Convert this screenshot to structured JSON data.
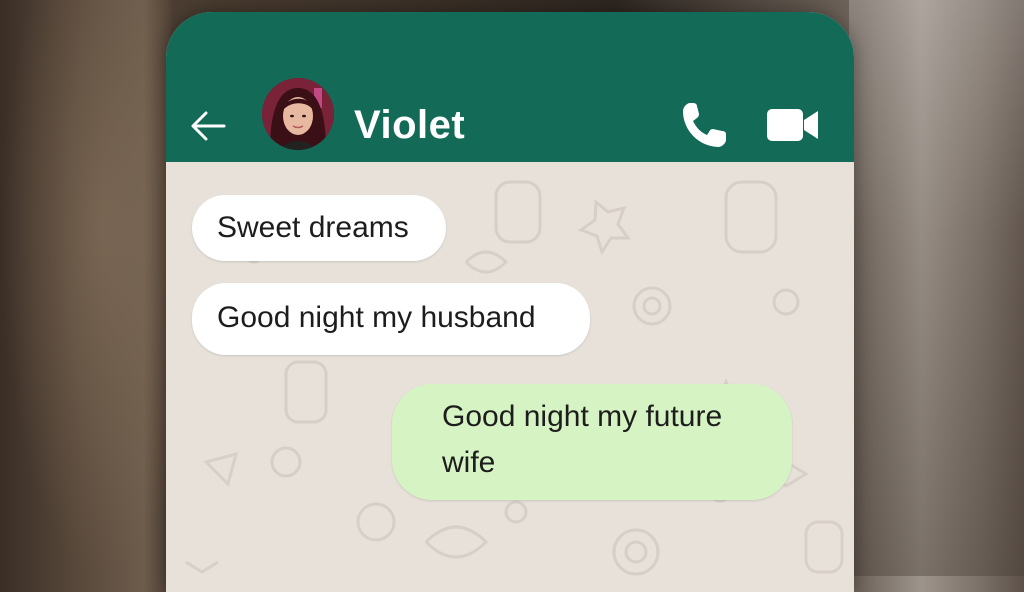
{
  "header": {
    "contact_name": "Violet",
    "back_icon": "arrow-left-icon",
    "call_icon": "phone-icon",
    "video_icon": "video-camera-icon"
  },
  "messages": [
    {
      "direction": "incoming",
      "text": "Sweet dreams"
    },
    {
      "direction": "incoming",
      "text": "Good night my husband"
    },
    {
      "direction": "outgoing",
      "text": "Good night my future wife"
    }
  ],
  "colors": {
    "header": "#136b57",
    "chat_background": "#e7e1da",
    "incoming_bubble": "#ffffff",
    "outgoing_bubble": "#d6f3c4"
  }
}
